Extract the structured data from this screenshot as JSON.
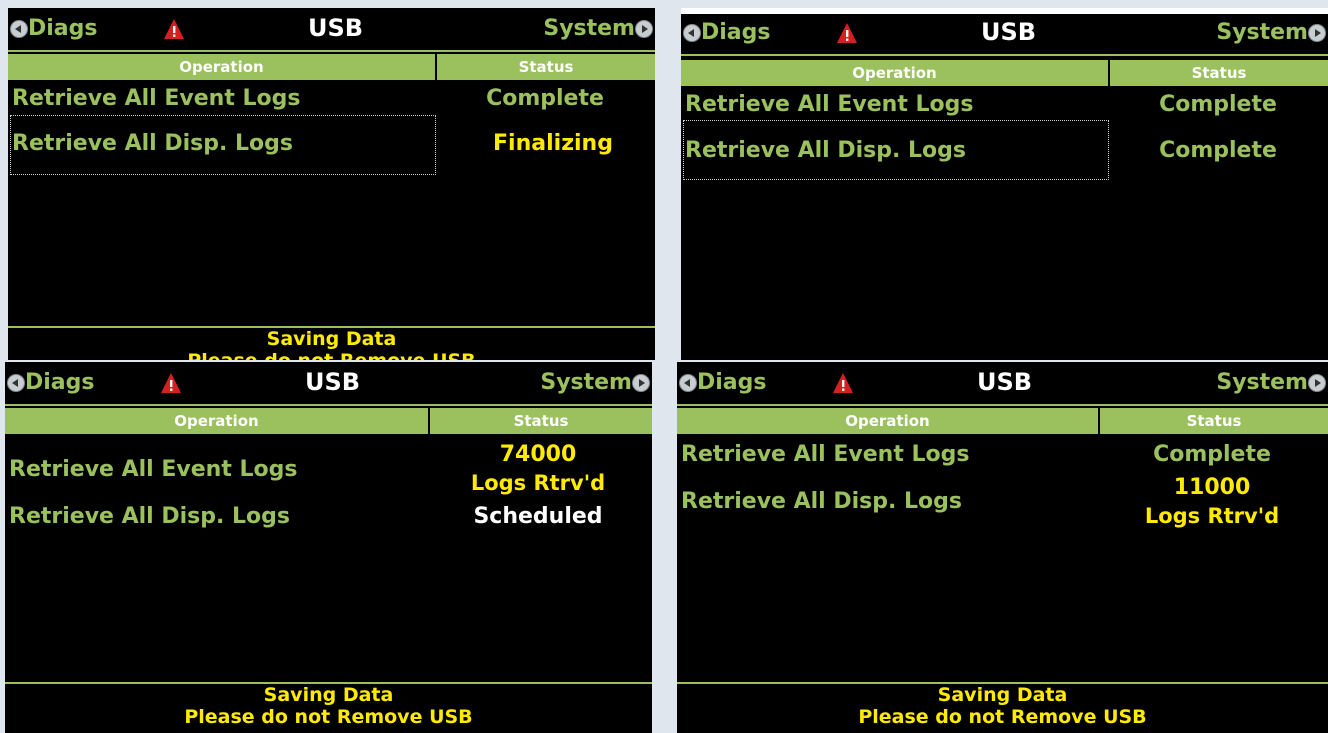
{
  "panels": [
    {
      "nav_left": "Diags",
      "title": "USB",
      "nav_right": "System",
      "col_operation": "Operation",
      "col_status": "Status",
      "rows": [
        {
          "operation": "Retrieve All Event Logs",
          "status": "Complete",
          "status_color": "#9bc05e"
        },
        {
          "operation": "Retrieve All Disp. Logs",
          "status": "Finalizing",
          "status_color": "#ffea00",
          "selected": true
        }
      ],
      "footer_line1": "Saving Data",
      "footer_line2": "Please do not Remove USB"
    },
    {
      "nav_left": "Diags",
      "title": "USB",
      "nav_right": "System",
      "col_operation": "Operation",
      "col_status": "Status",
      "rows": [
        {
          "operation": "Retrieve All Event Logs",
          "status": "Complete",
          "status_color": "#9bc05e"
        },
        {
          "operation": "Retrieve All Disp. Logs",
          "status": "Complete",
          "status_color": "#9bc05e",
          "selected": true
        }
      ]
    },
    {
      "nav_left": "Diags",
      "title": "USB",
      "nav_right": "System",
      "col_operation": "Operation",
      "col_status": "Status",
      "rows": [
        {
          "operation": "Retrieve All Event Logs",
          "status": "74000",
          "status_line2": "Logs Rtrv'd",
          "status_color": "#ffea00"
        },
        {
          "operation": "Retrieve All Disp. Logs",
          "status": "Scheduled",
          "status_color": "#ffffff"
        }
      ],
      "footer_line1": "Saving Data",
      "footer_line2": "Please do not Remove USB"
    },
    {
      "nav_left": "Diags",
      "title": "USB",
      "nav_right": "System",
      "col_operation": "Operation",
      "col_status": "Status",
      "rows": [
        {
          "operation": "Retrieve All Event Logs",
          "status": "Complete",
          "status_color": "#9bc05e"
        },
        {
          "operation": "Retrieve All Disp. Logs",
          "status": "11000",
          "status_line2": "Logs Rtrv'd",
          "status_color": "#ffea00"
        }
      ],
      "footer_line1": "Saving Data",
      "footer_line2": "Please do not Remove USB"
    }
  ],
  "colors": {
    "accent_green": "#9bc05e",
    "highlight_yellow": "#ffea00",
    "warning_red": "#d32020"
  }
}
